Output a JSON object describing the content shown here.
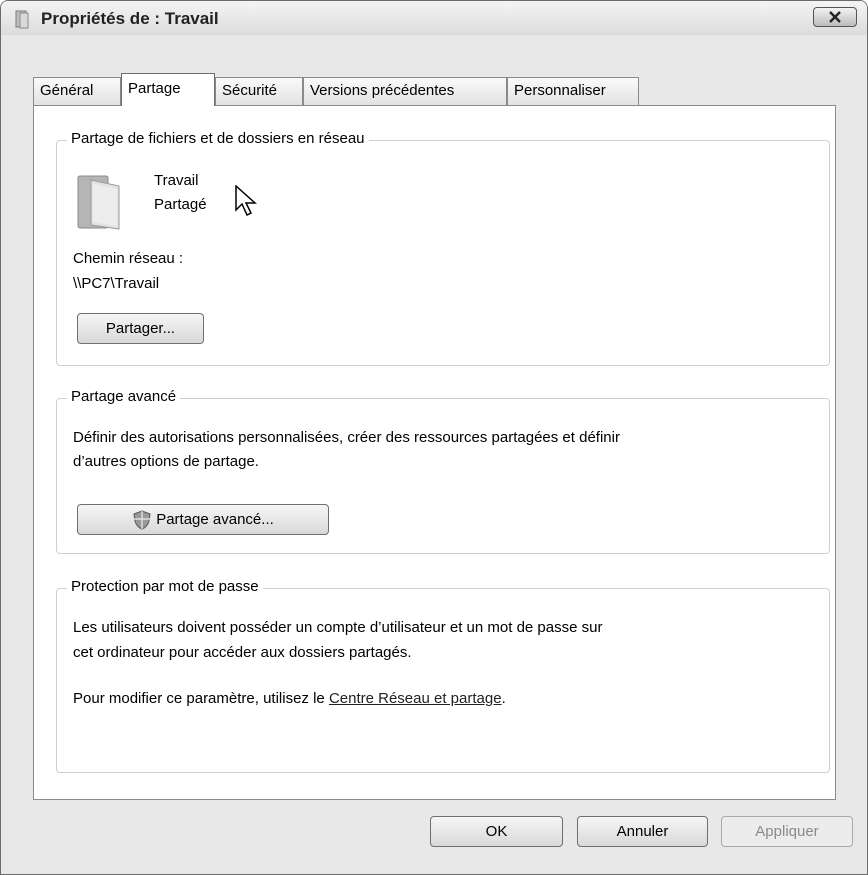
{
  "window": {
    "title": "Propriétés de : Travail"
  },
  "tabs": [
    {
      "label": "Général"
    },
    {
      "label": "Partage"
    },
    {
      "label": "Sécurité"
    },
    {
      "label": "Versions précédentes"
    },
    {
      "label": "Personnaliser"
    }
  ],
  "network_sharing": {
    "title": "Partage de fichiers et de dossiers en réseau",
    "folder_name": "Travail",
    "folder_status": "Partagé",
    "path_label": "Chemin réseau :",
    "path_value": "\\\\PC7\\Travail",
    "share_button": "Partager..."
  },
  "advanced_sharing": {
    "title": "Partage avancé",
    "description_line1": "Définir des autorisations personnalisées, créer des ressources partagées et définir",
    "description_line2": "d’autres options de partage.",
    "button": "Partage avancé..."
  },
  "password_protection": {
    "title": "Protection par mot de passe",
    "line1": "Les utilisateurs doivent posséder un compte d’utilisateur et un mot de passe sur",
    "line2": "cet ordinateur pour accéder aux dossiers partagés.",
    "modify_prefix": "Pour modifier ce paramètre, utilisez le ",
    "link": "Centre Réseau et partage",
    "modify_suffix": "."
  },
  "footer": {
    "ok": "OK",
    "cancel": "Annuler",
    "apply": "Appliquer"
  }
}
